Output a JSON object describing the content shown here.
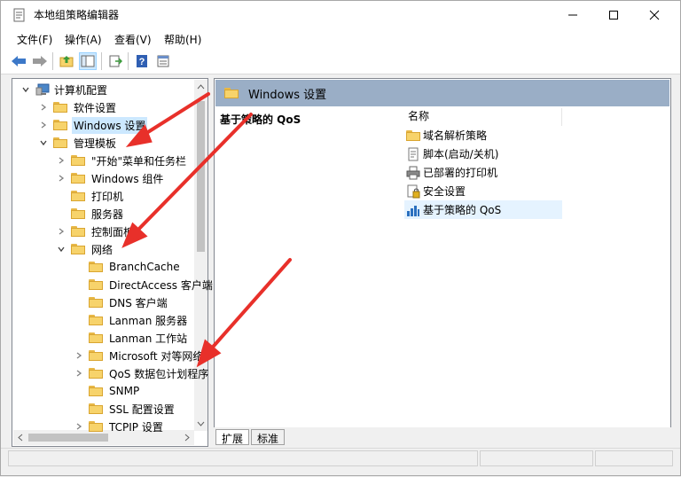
{
  "window": {
    "title": "本地组策略编辑器"
  },
  "menu": [
    "文件(F)",
    "操作(A)",
    "查看(V)",
    "帮助(H)"
  ],
  "tree": [
    {
      "label": "计算机配置",
      "level": 0,
      "toggle": "down",
      "kind": "computer",
      "top": 0
    },
    {
      "label": "软件设置",
      "level": 1,
      "toggle": "right",
      "kind": "folder"
    },
    {
      "label": "Windows 设置",
      "level": 1,
      "toggle": "right",
      "kind": "folder",
      "selected": true
    },
    {
      "label": "管理模板",
      "level": 1,
      "toggle": "down",
      "kind": "folder"
    },
    {
      "label": "\"开始\"菜单和任务栏",
      "level": 2,
      "toggle": "right",
      "kind": "folder"
    },
    {
      "label": "Windows 组件",
      "level": 2,
      "toggle": "right",
      "kind": "folder"
    },
    {
      "label": "打印机",
      "level": 2,
      "toggle": "",
      "kind": "folder"
    },
    {
      "label": "服务器",
      "level": 2,
      "toggle": "",
      "kind": "folder"
    },
    {
      "label": "控制面板",
      "level": 2,
      "toggle": "right",
      "kind": "folder"
    },
    {
      "label": "网络",
      "level": 2,
      "toggle": "down",
      "kind": "folder"
    },
    {
      "label": "BranchCache",
      "level": 3,
      "toggle": "",
      "kind": "folder"
    },
    {
      "label": "DirectAccess 客户端",
      "level": 3,
      "toggle": "",
      "kind": "folder"
    },
    {
      "label": "DNS 客户端",
      "level": 3,
      "toggle": "",
      "kind": "folder"
    },
    {
      "label": "Lanman 服务器",
      "level": 3,
      "toggle": "",
      "kind": "folder"
    },
    {
      "label": "Lanman 工作站",
      "level": 3,
      "toggle": "",
      "kind": "folder"
    },
    {
      "label": "Microsoft 对等网络",
      "level": 3,
      "toggle": "right",
      "kind": "folder"
    },
    {
      "label": "QoS 数据包计划程序",
      "level": 3,
      "toggle": "right",
      "kind": "folder"
    },
    {
      "label": "SNMP",
      "level": 3,
      "toggle": "",
      "kind": "folder"
    },
    {
      "label": "SSL 配置设置",
      "level": 3,
      "toggle": "",
      "kind": "folder"
    },
    {
      "label": "TCPIP 设置",
      "level": 3,
      "toggle": "right",
      "kind": "folder"
    }
  ],
  "right": {
    "header": "Windows 设置",
    "left_title": "基于策略的 QoS",
    "column": "名称",
    "items": [
      {
        "label": "域名解析策略",
        "icon": "folder-icon"
      },
      {
        "label": "脚本(启动/关机)",
        "icon": "script-icon"
      },
      {
        "label": "已部署的打印机",
        "icon": "printer-icon"
      },
      {
        "label": "安全设置",
        "icon": "security-icon"
      },
      {
        "label": "基于策略的 QoS",
        "icon": "qos-chart-icon",
        "selected": true
      }
    ]
  },
  "tabs": [
    "扩展",
    "标准"
  ]
}
